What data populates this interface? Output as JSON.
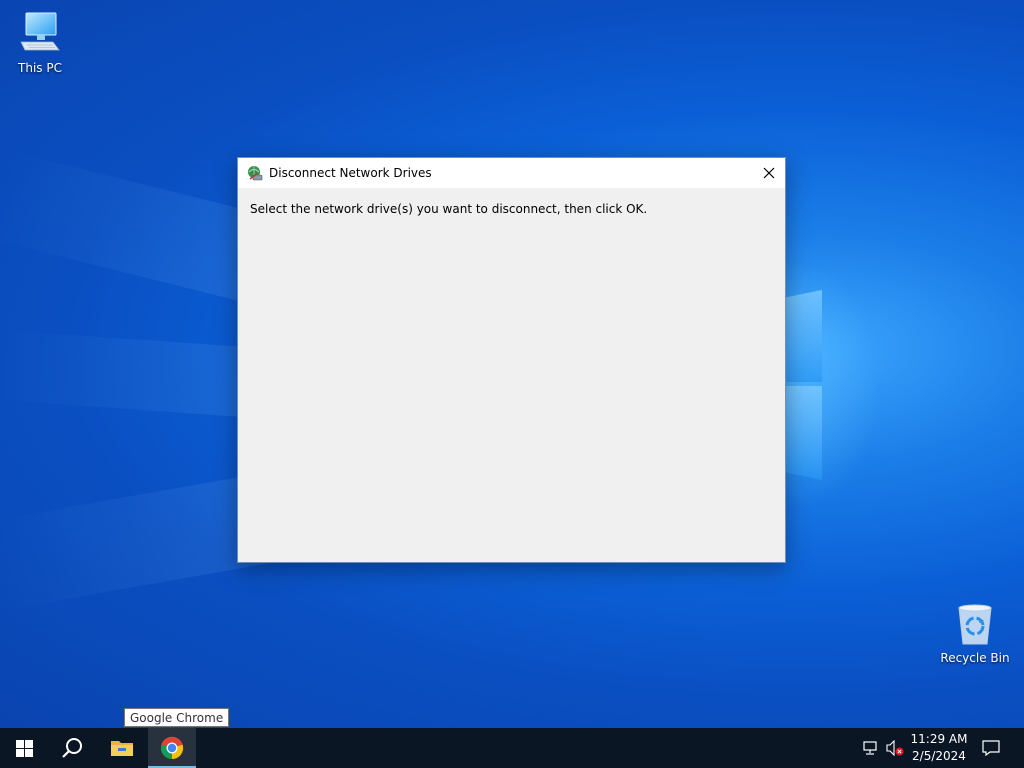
{
  "desktop": {
    "icons": [
      {
        "label": "This PC",
        "icon": "computer-icon"
      },
      {
        "label": "Recycle Bin",
        "icon": "recycle-bin-icon"
      }
    ]
  },
  "dialog": {
    "title": "Disconnect Network Drives",
    "icon": "network-drive-disconnect-icon",
    "instruction": "Select the network drive(s) you want to disconnect, then click OK."
  },
  "tooltip": {
    "text": "Google Chrome"
  },
  "taskbar": {
    "buttons": [
      {
        "name": "start",
        "icon": "windows-start-icon"
      },
      {
        "name": "search",
        "icon": "search-icon"
      },
      {
        "name": "file-explorer",
        "icon": "folder-icon"
      },
      {
        "name": "google-chrome",
        "icon": "chrome-icon",
        "active": true
      }
    ],
    "tray": {
      "network_icon": "network-disconnected-icon",
      "volume_icon": "volume-muted-icon",
      "notification_icon": "notification-icon"
    },
    "clock": {
      "time": "11:29 AM",
      "date": "2/5/2024"
    }
  },
  "colors": {
    "desktop_accent": "#0b5fd6",
    "taskbar": "#0b1625",
    "dialog_background": "#f0f0f0",
    "active_indicator": "#76b9ed"
  }
}
